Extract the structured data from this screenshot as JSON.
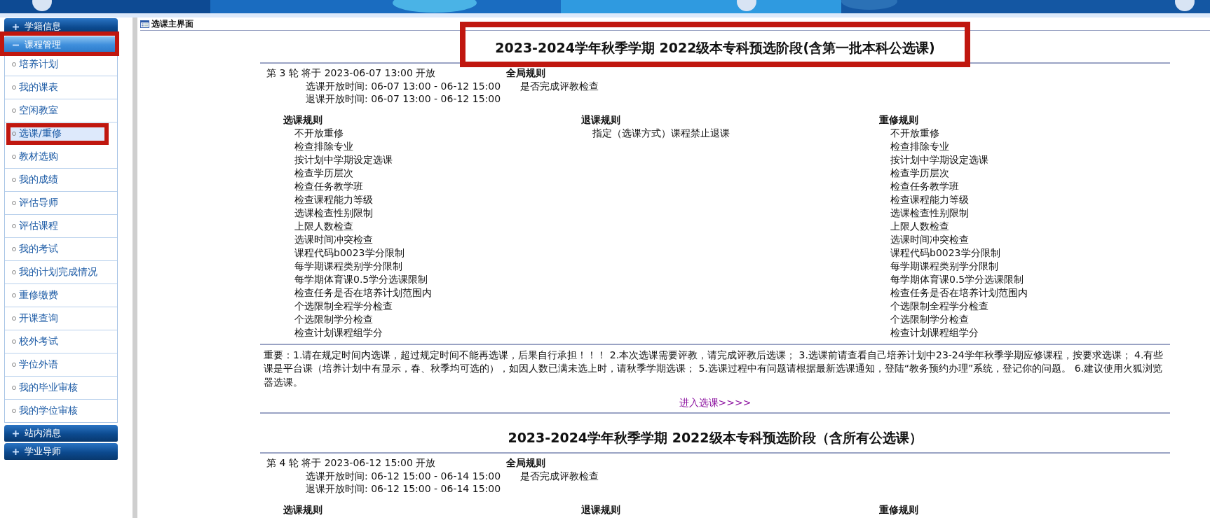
{
  "sidebar": {
    "groups": [
      {
        "label": "学籍信息",
        "expanded": false,
        "highlighted": false
      },
      {
        "label": "课程管理",
        "expanded": true,
        "highlighted": true,
        "items": [
          {
            "label": "培养计划",
            "selected": false,
            "highlighted": false
          },
          {
            "label": "我的课表",
            "selected": false,
            "highlighted": false
          },
          {
            "label": "空闲教室",
            "selected": false,
            "highlighted": false
          },
          {
            "label": "选课/重修",
            "selected": true,
            "highlighted": true
          },
          {
            "label": "教材选购",
            "selected": false,
            "highlighted": false
          },
          {
            "label": "我的成绩",
            "selected": false,
            "highlighted": false
          },
          {
            "label": "评估导师",
            "selected": false,
            "highlighted": false
          },
          {
            "label": "评估课程",
            "selected": false,
            "highlighted": false
          },
          {
            "label": "我的考试",
            "selected": false,
            "highlighted": false
          },
          {
            "label": "我的计划完成情况",
            "selected": false,
            "highlighted": false
          },
          {
            "label": "重修缴费",
            "selected": false,
            "highlighted": false
          },
          {
            "label": "开课查询",
            "selected": false,
            "highlighted": false
          },
          {
            "label": "校外考试",
            "selected": false,
            "highlighted": false
          },
          {
            "label": "学位外语",
            "selected": false,
            "highlighted": false
          },
          {
            "label": "我的毕业审核",
            "selected": false,
            "highlighted": false
          },
          {
            "label": "我的学位审核",
            "selected": false,
            "highlighted": false
          }
        ]
      },
      {
        "label": "站内消息",
        "expanded": false,
        "highlighted": false
      },
      {
        "label": "学业导师",
        "expanded": false,
        "highlighted": false
      }
    ]
  },
  "panel": {
    "title": "选课主界面",
    "rounds": [
      {
        "title": "2023-2024学年秋季学期 2022级本专科预选阶段(含第一批本科公选课)",
        "highlighted": true,
        "round_label": "第 3 轮 将于 2023-06-07 13:00 开放",
        "select_time": "选课开放时间: 06-07 13:00 - 06-12 15:00",
        "drop_time": "退课开放时间: 06-07 13:00 - 06-12 15:00",
        "global_rules_heading": "全局规则",
        "global_rules": [
          "是否完成评教检查"
        ],
        "rule_columns": [
          {
            "heading": "选课规则",
            "items": [
              "不开放重修",
              "检查排除专业",
              "按计划中学期设定选课",
              "检查学历层次",
              "检查任务教学班",
              "检查课程能力等级",
              "选课检查性别限制",
              "上限人数检查",
              "选课时间冲突检查",
              "课程代码b0023学分限制",
              "每学期课程类别学分限制",
              "每学期体育课0.5学分选课限制",
              "检查任务是否在培养计划范围内",
              "个选限制全程学分检查",
              "个选限制学分检查",
              "检查计划课程组学分"
            ]
          },
          {
            "heading": "退课规则",
            "items": [
              "指定（选课方式）课程禁止退课"
            ]
          },
          {
            "heading": "重修规则",
            "items": [
              "不开放重修",
              "检查排除专业",
              "按计划中学期设定选课",
              "检查学历层次",
              "检查任务教学班",
              "检查课程能力等级",
              "选课检查性别限制",
              "上限人数检查",
              "选课时间冲突检查",
              "课程代码b0023学分限制",
              "每学期课程类别学分限制",
              "每学期体育课0.5学分选课限制",
              "检查任务是否在培养计划范围内",
              "个选限制全程学分检查",
              "个选限制学分检查",
              "检查计划课程组学分"
            ]
          }
        ],
        "notice": "重要：1.请在规定时间内选课，超过规定时间不能再选课，后果自行承担！！！ 2.本次选课需要评教，请完成评教后选课； 3.选课前请查看自己培养计划中23-24学年秋季学期应修课程，按要求选课； 4.有些课是平台课（培养计划中有显示，春、秋季均可选的），如因人数已满未选上时，请秋季学期选课； 5.选课过程中有问题请根据最新选课通知，登陆“教务预约办理”系统，登记你的问题。 6.建议使用火狐浏览器选课。",
        "link": "进入选课>>>>"
      },
      {
        "title": "2023-2024学年秋季学期 2022级本专科预选阶段（含所有公选课）",
        "round_label": "第 4 轮 将于 2023-06-12 15:00 开放",
        "select_time": "选课开放时间: 06-12 15:00 - 06-14 15:00",
        "drop_time": "退课开放时间: 06-12 15:00 - 06-14 15:00",
        "global_rules_heading": "全局规则",
        "global_rules": [
          "是否完成评教检查"
        ],
        "rule_columns": [
          {
            "heading": "选课规则"
          },
          {
            "heading": "退课规则"
          },
          {
            "heading": "重修规则"
          }
        ]
      }
    ]
  }
}
